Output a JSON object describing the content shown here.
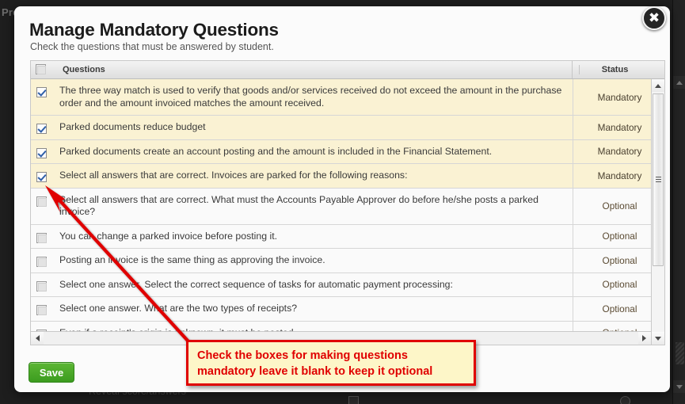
{
  "background": {
    "top_left_text": "Pres",
    "bottom_text": "Reveal score/answers"
  },
  "modal": {
    "title": "Manage Mandatory Questions",
    "subtitle": "Check the questions that must be answered by student.",
    "close_icon": "close-icon",
    "close_glyph": "✖"
  },
  "table": {
    "columns": [
      "Questions",
      "Status"
    ],
    "select_all_checked": false,
    "rows": [
      {
        "checked": true,
        "question": "The three way match is used to verify that goods and/or services received do not exceed the amount in the purchase order and the amount invoiced matches the amount received.",
        "status": "Mandatory"
      },
      {
        "checked": true,
        "question": "Parked documents reduce budget",
        "status": "Mandatory"
      },
      {
        "checked": true,
        "question": "Parked documents create an account posting and the amount is included in the Financial Statement.",
        "status": "Mandatory"
      },
      {
        "checked": true,
        "question": "Select all answers that are correct.  Invoices are parked for the following reasons:",
        "status": "Mandatory"
      },
      {
        "checked": false,
        "question": "Select all answers that are correct.  What must the Accounts Payable Approver do before he/she posts a parked invoice?",
        "status": "Optional"
      },
      {
        "checked": false,
        "question": "You can change a parked invoice before posting it.",
        "status": "Optional"
      },
      {
        "checked": false,
        "question": "Posting an invoice is the same thing as approving the invoice.",
        "status": "Optional"
      },
      {
        "checked": false,
        "question": "Select one answer.  Select the correct sequence of tasks for automatic payment processing:",
        "status": "Optional"
      },
      {
        "checked": false,
        "question": "Select one answer.  What are the two types of receipts?",
        "status": "Optional"
      },
      {
        "checked": false,
        "question": "Even if a receipt's origin is unknown, it must be posted.",
        "status": "Optional"
      }
    ]
  },
  "footer": {
    "save_label": "Save"
  },
  "annotation": {
    "text": "Check the boxes for making questions\nmandatory leave it blank to keep it optional",
    "border_color": "#e00000",
    "fill_color": "#fdf6c8",
    "text_color": "#e00000",
    "arrow_color": "#e00000"
  },
  "colors": {
    "mandatory_row_bg": "#faf2d3",
    "optional_row_bg": "#fafafa",
    "save_button_green": "#4aa828",
    "check_blue": "#2f5fa8"
  }
}
